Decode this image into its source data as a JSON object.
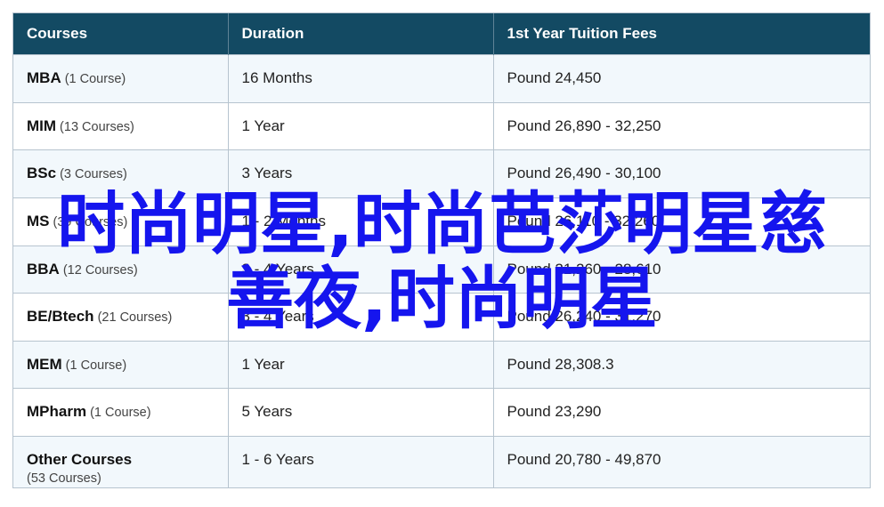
{
  "table": {
    "headers": [
      "Courses",
      "Duration",
      "1st Year Tuition Fees"
    ],
    "rows": [
      {
        "name": "MBA",
        "count": "(1 Course)",
        "duration": "16 Months",
        "fees": "Pound 24,450"
      },
      {
        "name": "MIM",
        "count": "(13 Courses)",
        "duration": "1 Year",
        "fees": "Pound 26,890 - 32,250"
      },
      {
        "name": "BSc",
        "count": "(3 Courses)",
        "duration": "3 Years",
        "fees": "Pound 26,490 - 30,100"
      },
      {
        "name": "MS",
        "count": "(39 Courses)",
        "duration": "1 - 2 Months",
        "fees": "Pound 26,110 - 32,260"
      },
      {
        "name": "BBA",
        "count": "(12 Courses)",
        "duration": "3 - 4 Years",
        "fees": "Pound 21,260 - 28,610"
      },
      {
        "name": "BE/Btech",
        "count": "(21 Courses)",
        "duration": "3 - 4 Years",
        "fees": "Pound 26,240 - 31,270"
      },
      {
        "name": "MEM",
        "count": "(1 Course)",
        "duration": "1 Year",
        "fees": "Pound 28,308.3"
      },
      {
        "name": "MPharm",
        "count": "(1 Course)",
        "duration": "5 Years",
        "fees": "Pound 23,290"
      },
      {
        "name": "Other Courses",
        "count": "(53 Courses)",
        "duration": "1 - 6 Years",
        "fees": "Pound 20,780 - 49,870"
      }
    ]
  },
  "overlay": {
    "line1": "时尚明星,时尚芭莎明星慈",
    "line2": "善夜,时尚明星"
  },
  "colors": {
    "header_bg": "#134a63",
    "alt_row_bg": "#f2f8fc",
    "overlay_text": "#1515ee"
  }
}
